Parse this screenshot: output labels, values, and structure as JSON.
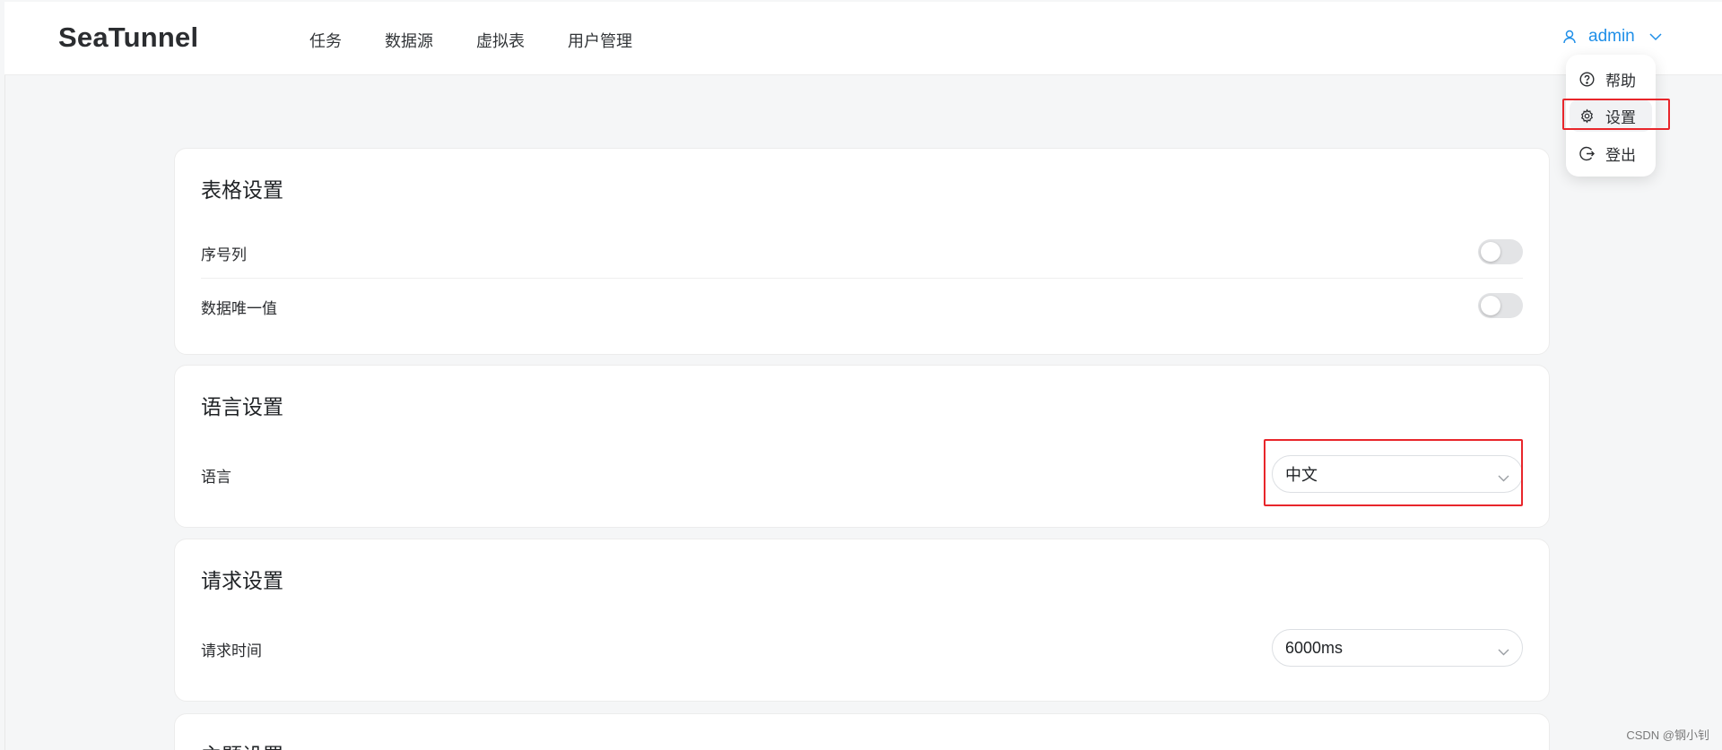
{
  "app": {
    "logo": "SeaTunnel"
  },
  "nav": {
    "items": [
      {
        "label": "任务"
      },
      {
        "label": "数据源"
      },
      {
        "label": "虚拟表"
      },
      {
        "label": "用户管理"
      }
    ]
  },
  "user": {
    "name": "admin",
    "icon": "user-icon",
    "caret": "chevron-down-icon"
  },
  "dropdown": {
    "items": [
      {
        "label": "帮助",
        "icon": "help-circle-icon"
      },
      {
        "label": "设置",
        "icon": "gear-icon",
        "active": true
      },
      {
        "label": "登出",
        "icon": "logout-icon"
      }
    ]
  },
  "table_settings": {
    "title": "表格设置",
    "rows": [
      {
        "label": "序号列",
        "enabled": false
      },
      {
        "label": "数据唯一值",
        "enabled": false
      }
    ]
  },
  "language_settings": {
    "title": "语言设置",
    "label": "语言",
    "value": "中文"
  },
  "request_settings": {
    "title": "请求设置",
    "label": "请求时间",
    "value": "6000ms"
  },
  "theme_settings": {
    "title": "主题设置"
  },
  "watermark": "CSDN @钢小钊",
  "colors": {
    "accent": "#1f8fe8",
    "highlight": "#e8262b",
    "switch_off": "#e3e4e6"
  }
}
